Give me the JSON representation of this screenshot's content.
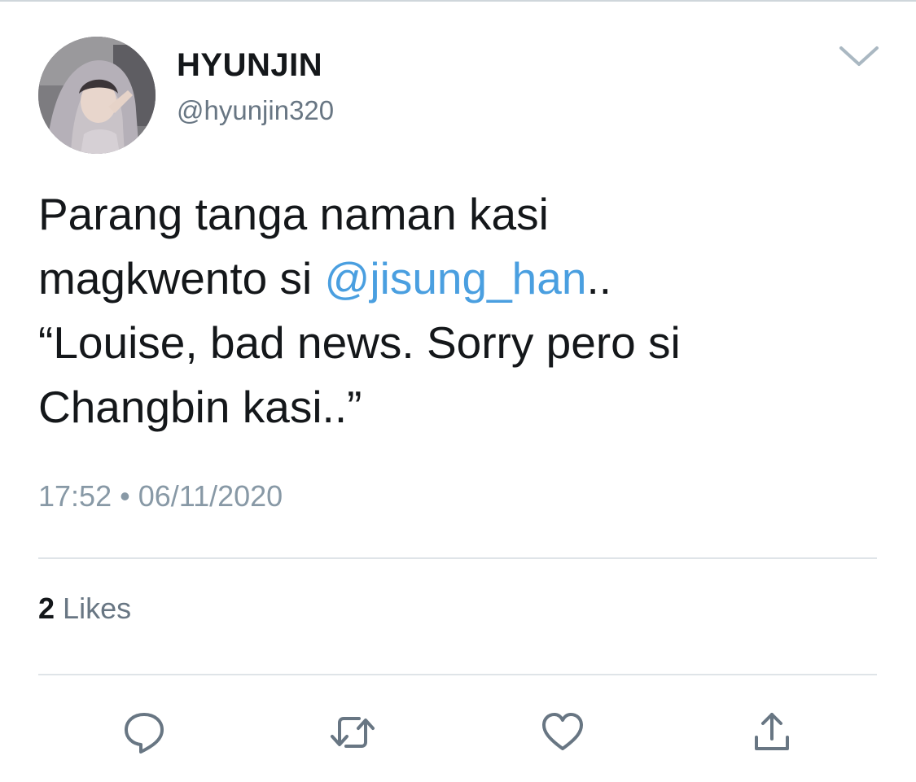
{
  "author": {
    "display_name": "HYUNJIN",
    "handle": "@hyunjin320",
    "avatar_icon": "profile-photo"
  },
  "tweet": {
    "lines": [
      [
        "Parang tanga naman kasi"
      ],
      [
        "magkwento si ",
        "@jisung_han",
        ".."
      ],
      [
        "“Louise, bad news. Sorry pero si"
      ],
      [
        "Changbin kasi..”"
      ]
    ],
    "mention": "@jisung_han",
    "timestamp": "17:52 • 06/11/2020"
  },
  "stats": {
    "likes_count": "2",
    "likes_label": "Likes"
  },
  "actions": {
    "reply_icon": "reply-icon",
    "retweet_icon": "retweet-icon",
    "like_icon": "heart-icon",
    "share_icon": "share-icon",
    "menu_icon": "chevron-down-icon"
  },
  "colors": {
    "mention": "#4a9fe0",
    "secondary_text": "#687683",
    "icon": "#687683",
    "divider": "#dfe4e8"
  }
}
